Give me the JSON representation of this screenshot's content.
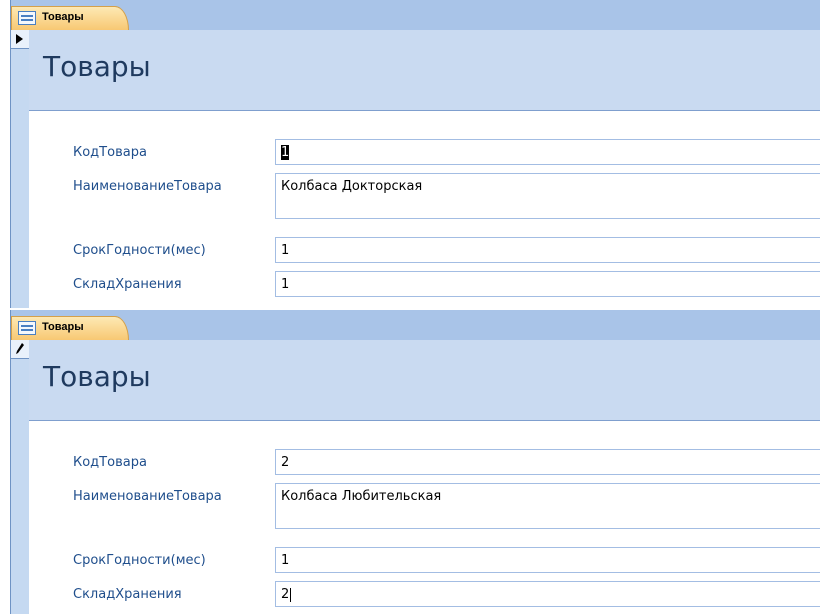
{
  "forms": [
    {
      "tab": {
        "label": "Товары",
        "icon": "form-icon"
      },
      "title": "Товары",
      "record_selector_icon": "current-record-arrow-icon",
      "fields": [
        {
          "label": "КодТовара",
          "value": "1"
        },
        {
          "label": "НаименованиеТовара",
          "value": "Колбаса Докторская"
        },
        {
          "label": "СрокГодности(мес)",
          "value": "1"
        },
        {
          "label": "СкладХранения",
          "value": "1"
        }
      ]
    },
    {
      "tab": {
        "label": "Товары",
        "icon": "form-icon"
      },
      "title": "Товары",
      "record_selector_icon": "editing-pencil-icon",
      "fields": [
        {
          "label": "КодТовара",
          "value": "2"
        },
        {
          "label": "НаименованиеТовара",
          "value": "Колбаса Любительская"
        },
        {
          "label": "СрокГодности(мес)",
          "value": "1"
        },
        {
          "label": "СкладХранения",
          "value": "2"
        }
      ]
    }
  ],
  "colors": {
    "tab_strip": "#a9c4e8",
    "header_band": "#c9daf1",
    "label_text": "#1f4e8c",
    "field_border": "#a3bde3"
  }
}
